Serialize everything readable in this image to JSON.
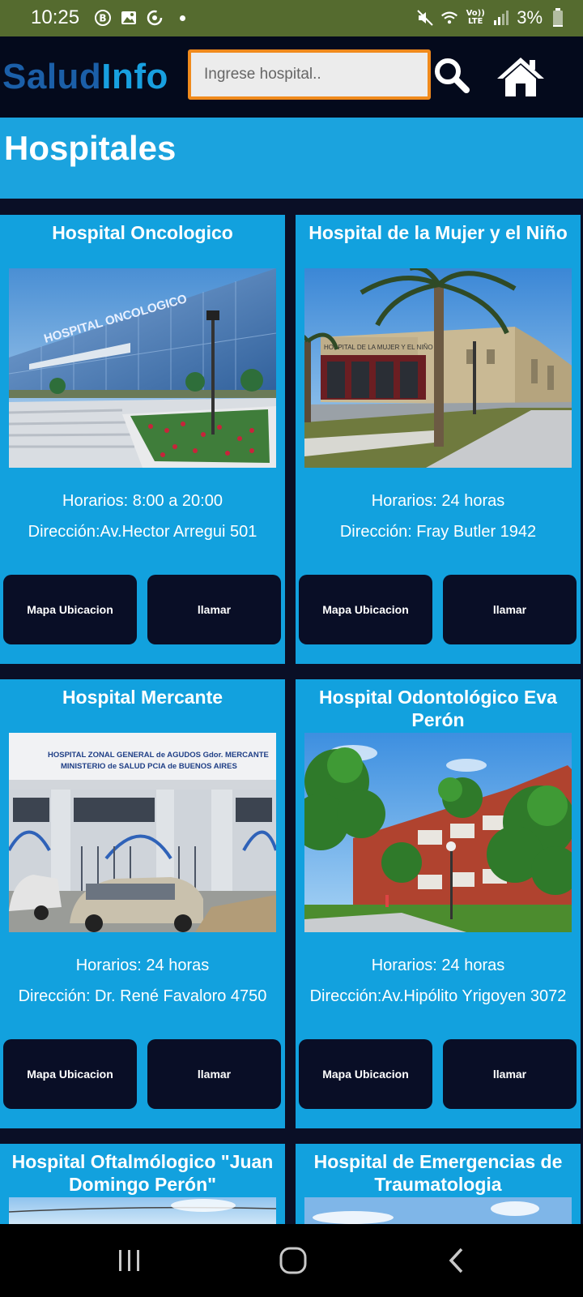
{
  "status_bar": {
    "time": "10:25",
    "battery": "3%",
    "volte": "Vo)) LTE",
    "icons": [
      "b-icon",
      "image-icon",
      "sync-icon",
      "dot",
      "mute-icon",
      "wifi-icon",
      "volte-icon",
      "signal-icon",
      "battery-icon"
    ]
  },
  "header": {
    "brand_part1": "Salud",
    "brand_part2": "Info",
    "search_placeholder": "Ingrese hospital..",
    "search_value": "",
    "search_icon": "search-icon",
    "home_icon": "home-icon"
  },
  "page": {
    "title": "Hospitales"
  },
  "hospitals": [
    {
      "name": "Hospital Oncologico",
      "hours": "Horarios: 8:00 a 20:00",
      "address": "Dirección:Av.Hector Arregui 501",
      "map_label": "Mapa Ubicacion",
      "call_label": "llamar"
    },
    {
      "name": "Hospital de la Mujer y el Niño",
      "hours": "Horarios: 24 horas",
      "address": "Dirección: Fray Butler 1942",
      "map_label": "Mapa Ubicacion",
      "call_label": "llamar"
    },
    {
      "name": "Hospital Mercante",
      "hours": "Horarios: 24 horas",
      "address": "Dirección: Dr. René Favaloro 4750",
      "map_label": "Mapa Ubicacion",
      "call_label": "llamar"
    },
    {
      "name": "Hospital Odontológico Eva Perón",
      "hours": "Horarios: 24 horas",
      "address": "Dirección:Av.Hipólito Yrigoyen 3072",
      "map_label": "Mapa  Ubicacion",
      "call_label": "llamar"
    },
    {
      "name": "Hospital Oftalmólogico \"Juan Domingo Perón\"",
      "hours": "",
      "address": "",
      "map_label": "",
      "call_label": ""
    },
    {
      "name": "Hospital de Emergencias de Traumatologia",
      "hours": "",
      "address": "",
      "map_label": "",
      "call_label": ""
    }
  ],
  "photo_signs": {
    "oncologico": "HOSPITAL ONCOLOGICO",
    "mujer": "HOSPITAL DE LA MUJER Y EL NIÑO",
    "mercante_line1": "HOSPITAL ZONAL GENERAL de AGUDOS Gdor. MERCANTE",
    "mercante_line2": "MINISTERIO de SALUD PCIA de BUENOS AIRES"
  },
  "nav_bar": {
    "recent_icon": "recent-apps-icon",
    "home_icon": "nav-home-icon",
    "back_icon": "back-icon"
  },
  "colors": {
    "status_bar": "#556b2f",
    "header_bg": "#040a1c",
    "brand_dark": "#1b5fa8",
    "brand_light": "#18a0e0",
    "search_border": "#f08a1c",
    "card_bg": "#12a1de",
    "button_bg": "#090e26"
  }
}
